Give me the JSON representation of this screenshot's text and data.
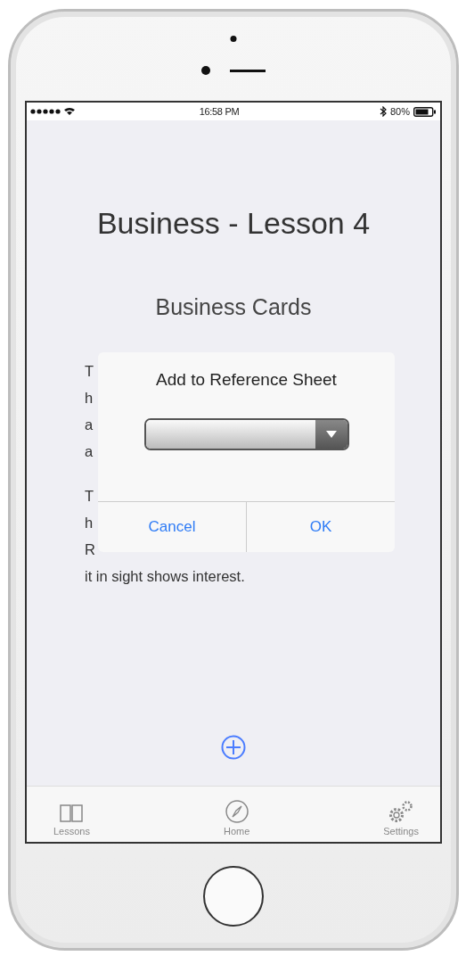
{
  "status_bar": {
    "time": "16:58 PM",
    "battery": "80%"
  },
  "title": "Business - Lesson 4",
  "subtitle": "Business Cards",
  "paragraphs": [
    {
      "lines": [
        "T",
        "h",
        "a",
        "a"
      ]
    },
    {
      "lines": [
        "T",
        "h",
        "R",
        "it in sight shows interest."
      ]
    }
  ],
  "dialog": {
    "title": "Add to Reference Sheet",
    "buttons": [
      "Cancel",
      "OK"
    ]
  },
  "tabs": [
    {
      "label": "Lessons",
      "kind": "book",
      "selected": false
    },
    {
      "label": "Home",
      "kind": "compass",
      "selected": false
    },
    {
      "label": "Settings",
      "kind": "gears",
      "selected": false
    }
  ]
}
